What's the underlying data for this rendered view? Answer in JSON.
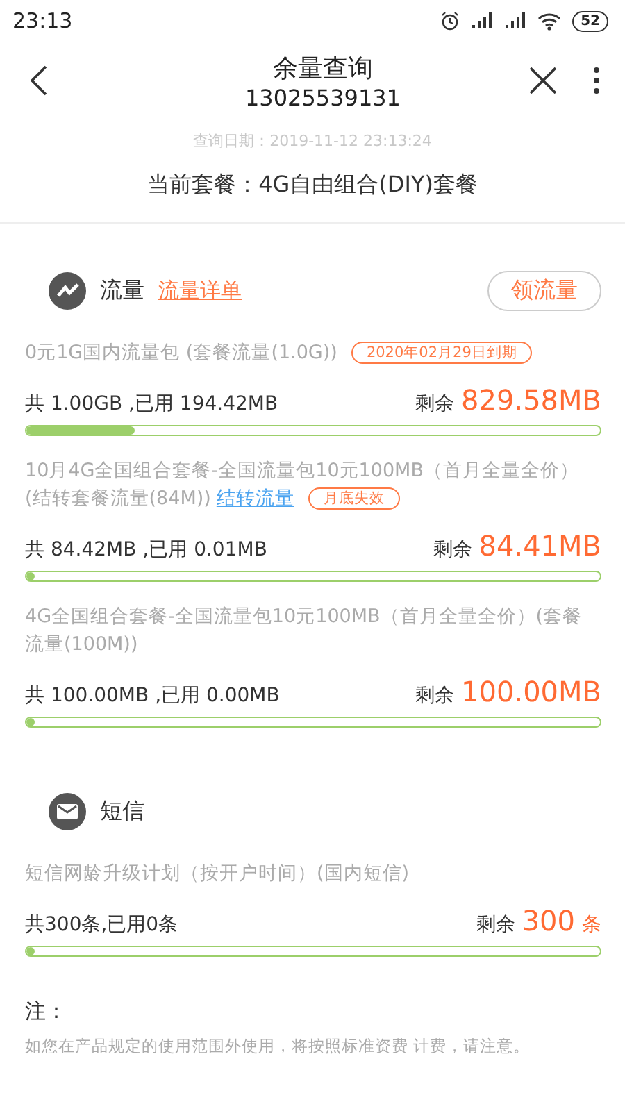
{
  "status_bar": {
    "time": "23:13",
    "battery": "52"
  },
  "header": {
    "title": "余量查询",
    "subtitle": "13025539131"
  },
  "query_date": "查询日期：2019-11-12 23:13:24",
  "current_plan": "当前套餐：4G自由组合(DIY)套餐",
  "sections": [
    {
      "kind": "data",
      "title": "流量",
      "link": "流量详单",
      "action": "领流量",
      "items": [
        {
          "description": "0元1G国内流量包 (套餐流量(1.0G))",
          "tag": "2020年02月29日到期",
          "usage": "共 1.00GB ,已用 194.42MB",
          "remaining_label": "剩余",
          "remaining": "829.58MB",
          "level": 0.19
        },
        {
          "description": "10月4G全国组合套餐-全国流量包10元100MB（首月全量全价）(结转套餐流量(84M))",
          "link": "结转流量",
          "tag": "月底失效",
          "usage": "共 84.42MB ,已用 0.01MB",
          "remaining_label": "剩余",
          "remaining": "84.41MB",
          "level": 0.0001
        },
        {
          "description": "4G全国组合套餐-全国流量包10元100MB（首月全量全价）(套餐流量(100M))",
          "usage": "共 100.00MB ,已用 0.00MB",
          "remaining_label": "剩余",
          "remaining": "100.00MB",
          "level": 0
        }
      ]
    },
    {
      "kind": "sms",
      "title": "短信",
      "items": [
        {
          "description": "短信网龄升级计划（按开户时间）(国内短信)",
          "usage": "共300条,已用0条",
          "remaining_label": "剩余",
          "remaining": "300",
          "unit": "条",
          "level": 0
        }
      ]
    }
  ],
  "note": {
    "title": "注：",
    "text": "如您在产品规定的使用范围外使用，将按照标准资费 计费，请注意。"
  }
}
